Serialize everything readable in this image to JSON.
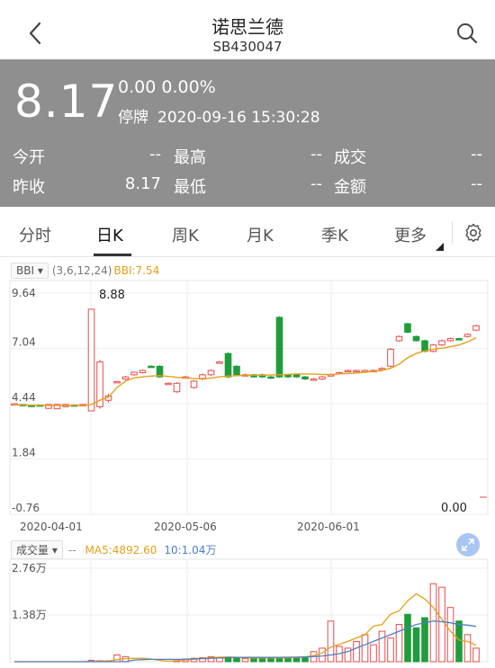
{
  "header": {
    "title": "诺思兰德",
    "code": "SB430047"
  },
  "quote": {
    "price": "8.17",
    "change": "0.00",
    "change_pct": "0.00%",
    "status": "停牌",
    "datetime": "2020-09-16 15:30:28",
    "stats": [
      [
        {
          "label": "今开",
          "value": "--"
        },
        {
          "label": "最高",
          "value": "--"
        },
        {
          "label": "成交",
          "value": "--"
        }
      ],
      [
        {
          "label": "昨收",
          "value": "8.17"
        },
        {
          "label": "最低",
          "value": "--"
        },
        {
          "label": "金额",
          "value": "--"
        }
      ]
    ]
  },
  "tabs": [
    {
      "label": "分时"
    },
    {
      "label": "日K"
    },
    {
      "label": "周K"
    },
    {
      "label": "月K"
    },
    {
      "label": "季K"
    },
    {
      "label": "更多"
    }
  ],
  "active_tab": 1,
  "indicator": {
    "name": "BBI",
    "params": "(3,6,12,24)",
    "value_label": "BBI:7.54"
  },
  "volume_indicator": {
    "name": "成交量",
    "dash": "--",
    "ma5": "MA5:4892.60",
    "ma10": "10:1.04万"
  },
  "colors": {
    "up": "#e84a4a",
    "down": "#1f9d3a",
    "bbi": "#e5a01a",
    "ma10": "#4d7fc4",
    "panel": "#8f8f8f"
  },
  "chart_data": {
    "type": "candlestick",
    "price_axis": {
      "ticks": [
        "9.64",
        "7.04",
        "4.44",
        "1.84",
        "-0.76"
      ],
      "ylim": [
        -0.76,
        9.64
      ]
    },
    "date_ticks": [
      "2020-04-01",
      "2020-05-06",
      "2020-06-01"
    ],
    "max_label": "8.88",
    "min_label": "0.00",
    "candles": [
      [
        4.4,
        4.44,
        4.36,
        4.46
      ],
      [
        4.4,
        4.36,
        4.33,
        4.42
      ],
      [
        4.38,
        4.3,
        4.28,
        4.4
      ],
      [
        4.38,
        4.36,
        4.34,
        4.4
      ],
      [
        4.22,
        4.4,
        4.2,
        4.42
      ],
      [
        4.2,
        4.4,
        4.18,
        4.42
      ],
      [
        4.3,
        4.4,
        4.28,
        4.42
      ],
      [
        4.38,
        4.36,
        4.34,
        4.4
      ],
      [
        4.4,
        4.4,
        4.38,
        4.42
      ],
      [
        4.1,
        8.88,
        4.1,
        8.88
      ],
      [
        4.3,
        6.4,
        4.2,
        6.5
      ],
      [
        4.6,
        4.8,
        4.5,
        4.9
      ],
      [
        5.45,
        5.48,
        5.4,
        5.5
      ],
      [
        5.6,
        5.7,
        5.55,
        5.75
      ],
      [
        5.8,
        5.92,
        5.75,
        5.95
      ],
      [
        5.9,
        6.0,
        5.85,
        6.05
      ],
      [
        6.2,
        6.18,
        6.15,
        6.25
      ],
      [
        6.2,
        5.7,
        5.65,
        6.25
      ],
      [
        5.4,
        5.4,
        5.35,
        5.45
      ],
      [
        5.0,
        5.4,
        4.95,
        5.45
      ],
      [
        5.7,
        5.7,
        5.65,
        5.75
      ],
      [
        5.2,
        5.5,
        5.15,
        5.55
      ],
      [
        5.6,
        5.8,
        5.55,
        5.85
      ],
      [
        5.8,
        6.0,
        5.75,
        6.05
      ],
      [
        6.4,
        6.4,
        6.35,
        6.45
      ],
      [
        6.8,
        5.7,
        5.65,
        6.85
      ],
      [
        6.2,
        5.8,
        5.75,
        6.25
      ],
      [
        5.8,
        5.8,
        5.75,
        5.85
      ],
      [
        5.8,
        5.7,
        5.65,
        5.85
      ],
      [
        5.8,
        5.7,
        5.65,
        5.85
      ],
      [
        5.7,
        5.65,
        5.6,
        5.75
      ],
      [
        8.5,
        5.7,
        5.65,
        8.55
      ],
      [
        5.8,
        5.7,
        5.65,
        5.85
      ],
      [
        5.8,
        5.7,
        5.65,
        5.85
      ],
      [
        5.7,
        5.6,
        5.55,
        5.75
      ],
      [
        5.6,
        5.6,
        5.55,
        5.65
      ],
      [
        5.6,
        5.7,
        5.55,
        5.75
      ],
      [
        5.8,
        5.8,
        5.75,
        5.85
      ],
      [
        5.9,
        5.9,
        5.85,
        5.95
      ],
      [
        6.0,
        6.0,
        5.95,
        6.05
      ],
      [
        6.0,
        6.0,
        5.95,
        6.05
      ],
      [
        6.0,
        6.0,
        5.95,
        6.05
      ],
      [
        6.0,
        6.0,
        5.95,
        6.05
      ],
      [
        6.1,
        6.1,
        6.05,
        6.15
      ],
      [
        6.2,
        7.0,
        6.15,
        7.05
      ],
      [
        7.4,
        7.6,
        7.35,
        7.65
      ],
      [
        8.2,
        7.8,
        7.75,
        8.25
      ],
      [
        7.6,
        7.4,
        7.35,
        7.65
      ],
      [
        7.4,
        6.9,
        6.85,
        7.45
      ],
      [
        6.9,
        7.2,
        6.85,
        7.25
      ],
      [
        7.2,
        7.4,
        7.15,
        7.45
      ],
      [
        7.4,
        7.5,
        7.35,
        7.55
      ],
      [
        7.5,
        7.48,
        7.45,
        7.55
      ],
      [
        7.6,
        7.7,
        7.55,
        7.75
      ],
      [
        7.9,
        8.1,
        7.85,
        8.15
      ]
    ],
    "bbi_values": [
      4.38,
      4.38,
      4.37,
      4.37,
      4.36,
      4.36,
      4.36,
      4.36,
      4.36,
      4.4,
      4.6,
      4.75,
      5.2,
      5.5,
      5.65,
      5.7,
      5.74,
      5.76,
      5.72,
      5.68,
      5.65,
      5.62,
      5.62,
      5.65,
      5.7,
      5.74,
      5.76,
      5.77,
      5.78,
      5.78,
      5.79,
      5.8,
      5.82,
      5.84,
      5.84,
      5.83,
      5.82,
      5.82,
      5.84,
      5.86,
      5.88,
      5.92,
      5.96,
      6.0,
      6.1,
      6.3,
      6.6,
      6.8,
      6.92,
      7.0,
      7.05,
      7.12,
      7.2,
      7.35,
      7.54
    ],
    "volume_axis": {
      "ticks": [
        "2.76万",
        "1.38万"
      ],
      "ylim": [
        0,
        27600
      ]
    },
    "volumes": [
      0,
      0,
      0,
      0,
      0,
      0,
      0,
      0,
      0,
      400,
      300,
      300,
      2000,
      1500,
      0,
      0,
      0,
      0,
      0,
      600,
      800,
      1000,
      1200,
      1500,
      1300,
      1400,
      1200,
      900,
      900,
      800,
      1000,
      1100,
      1000,
      1200,
      1100,
      3000,
      4000,
      12000,
      4500,
      4000,
      6000,
      8000,
      5000,
      9000,
      7000,
      11000,
      14000,
      10000,
      13000,
      23000,
      22000,
      16000,
      12000,
      8000,
      4000
    ],
    "volume_ma5": [
      0,
      0,
      0,
      0,
      0,
      0,
      0,
      0,
      0,
      80,
      140,
      200,
      600,
      900,
      1000,
      1000,
      800,
      400,
      120,
      240,
      500,
      680,
      1000,
      1200,
      1360,
      1360,
      1320,
      1120,
      1140,
      1100,
      1140,
      1160,
      1180,
      1220,
      1400,
      1800,
      2600,
      4300,
      5100,
      6000,
      7000,
      8000,
      10500,
      11000,
      14000,
      15000,
      18000,
      20000,
      18500,
      16000,
      12500,
      9000,
      6400,
      6000,
      4892
    ],
    "volume_ma10": [
      0,
      0,
      0,
      0,
      0,
      0,
      0,
      0,
      0,
      0,
      0,
      0,
      0,
      0,
      500,
      600,
      700,
      700,
      700,
      700,
      760,
      820,
      900,
      1000,
      1100,
      1200,
      1300,
      1300,
      1300,
      1300,
      1300,
      1300,
      1320,
      1360,
      1400,
      1500,
      1700,
      2000,
      2400,
      3000,
      4000,
      5000,
      6000,
      7000,
      8000,
      9000,
      10000,
      11000,
      11500,
      12000,
      11800,
      11500,
      11000,
      10800,
      10400
    ]
  }
}
